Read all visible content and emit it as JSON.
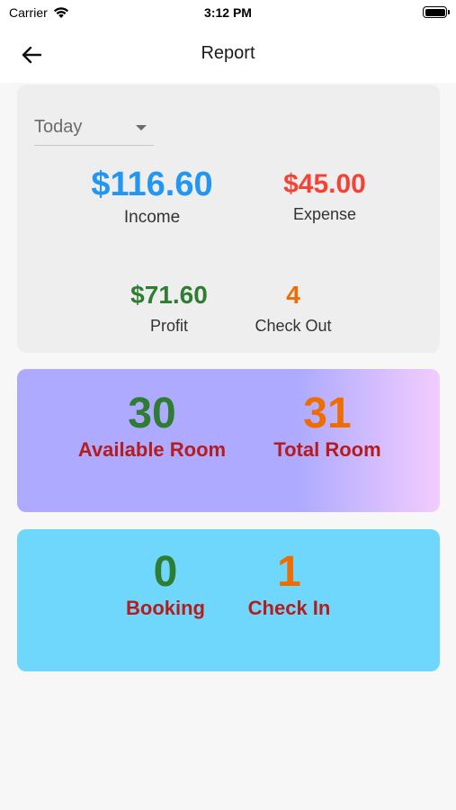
{
  "status_bar": {
    "carrier": "Carrier",
    "time": "3:12 PM"
  },
  "app_bar": {
    "title": "Report",
    "back_icon": "arrow-left-icon"
  },
  "summary": {
    "period": "Today",
    "income": {
      "value": "$116.60",
      "label": "Income"
    },
    "expense": {
      "value": "$45.00",
      "label": "Expense"
    },
    "profit": {
      "value": "$71.60",
      "label": "Profit"
    },
    "check_out": {
      "value": "4",
      "label": "Check Out"
    }
  },
  "rooms": {
    "available": {
      "value": "30",
      "label": "Available Room"
    },
    "total": {
      "value": "31",
      "label": "Total Room"
    }
  },
  "bookings": {
    "booking": {
      "value": "0",
      "label": "Booking"
    },
    "check_in": {
      "value": "1",
      "label": "Check In"
    }
  },
  "colors": {
    "income": "#2196f3",
    "expense": "#f44336",
    "positive": "#2e7d32",
    "accent_orange": "#ef6c00",
    "label_red": "#b71c1c",
    "rooms_card": "#adaaff",
    "bookings_card": "#6ed7fb"
  }
}
